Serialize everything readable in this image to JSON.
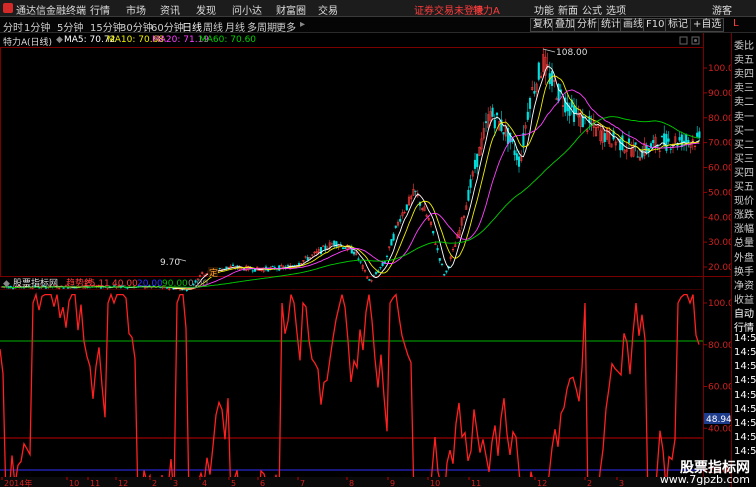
{
  "menubar": {
    "app_name": "通达信金融终端",
    "menus": [
      "行情",
      "市场",
      "资讯",
      "发现",
      "问小达",
      "财富圈",
      "交易"
    ],
    "warning": "证券交易未登录",
    "symbol": "特力A",
    "right_menus": [
      "功能",
      "新面",
      "公式",
      "选项",
      "游客"
    ]
  },
  "periods": [
    "分时",
    "1分钟",
    "5分钟",
    "15分钟",
    "30分钟",
    "60分钟",
    "日线",
    "周线",
    "月线",
    "多周期",
    "更多"
  ],
  "active_period": "日线",
  "right_buttons": [
    "复权",
    "叠加",
    "分析",
    "统计",
    "画线",
    "F10",
    "标记",
    "+自选"
  ],
  "info": {
    "stock": "特力A",
    "period": "(日线)",
    "ma5": "MA5: 70.72",
    "ma10": "MA10: 70.68",
    "ma20": "MA20: 71.19",
    "ma60": "MA60: 70.60"
  },
  "price_axis": [
    "100.0",
    "90.00",
    "80.00",
    "70.00",
    "60.00",
    "50.00",
    "40.00",
    "30.00",
    "20.00"
  ],
  "peak_label": "108.00",
  "low_label": "9.70",
  "ding_label": "定",
  "indicator": {
    "source": "股票指标网",
    "name": "趋势线",
    "value": "25.11",
    "level1": "40.00",
    "level2": "20.00",
    "level3": "90.00",
    "level4": "0.00",
    "current": "48.94"
  },
  "indicator_axis": [
    "100.0",
    "80.00",
    "60.00",
    "40.00",
    "20.00"
  ],
  "date_axis": [
    "2014年",
    "10",
    "11",
    "12",
    "2",
    "3",
    "4",
    "5",
    "6",
    "7",
    "8",
    "9",
    "10",
    "11",
    "12",
    "2",
    "3"
  ],
  "side_labels": [
    "委比",
    "卖五",
    "卖四",
    "卖三",
    "卖二",
    "卖一",
    "买一",
    "买二",
    "买三",
    "买四",
    "买五",
    "现价",
    "涨跌",
    "涨幅",
    "总量",
    "外盘",
    "换手",
    "净资",
    "收益",
    "自动",
    "行情",
    "14:5",
    "14:5",
    "14:5",
    "14:5",
    "14:5",
    "14:5",
    "14:5",
    "14:5",
    "14:5"
  ],
  "side_top": "L",
  "watermark": {
    "line1": "股票指标网",
    "line2": "www.7gpzb.com"
  },
  "colors": {
    "up": "#ff3c3c",
    "down": "#00e0e0",
    "ma5": "#ffffff",
    "ma10": "#f0f000",
    "ma20": "#ff40ff",
    "ma60": "#00d000",
    "indicator": "#ff2020"
  }
}
